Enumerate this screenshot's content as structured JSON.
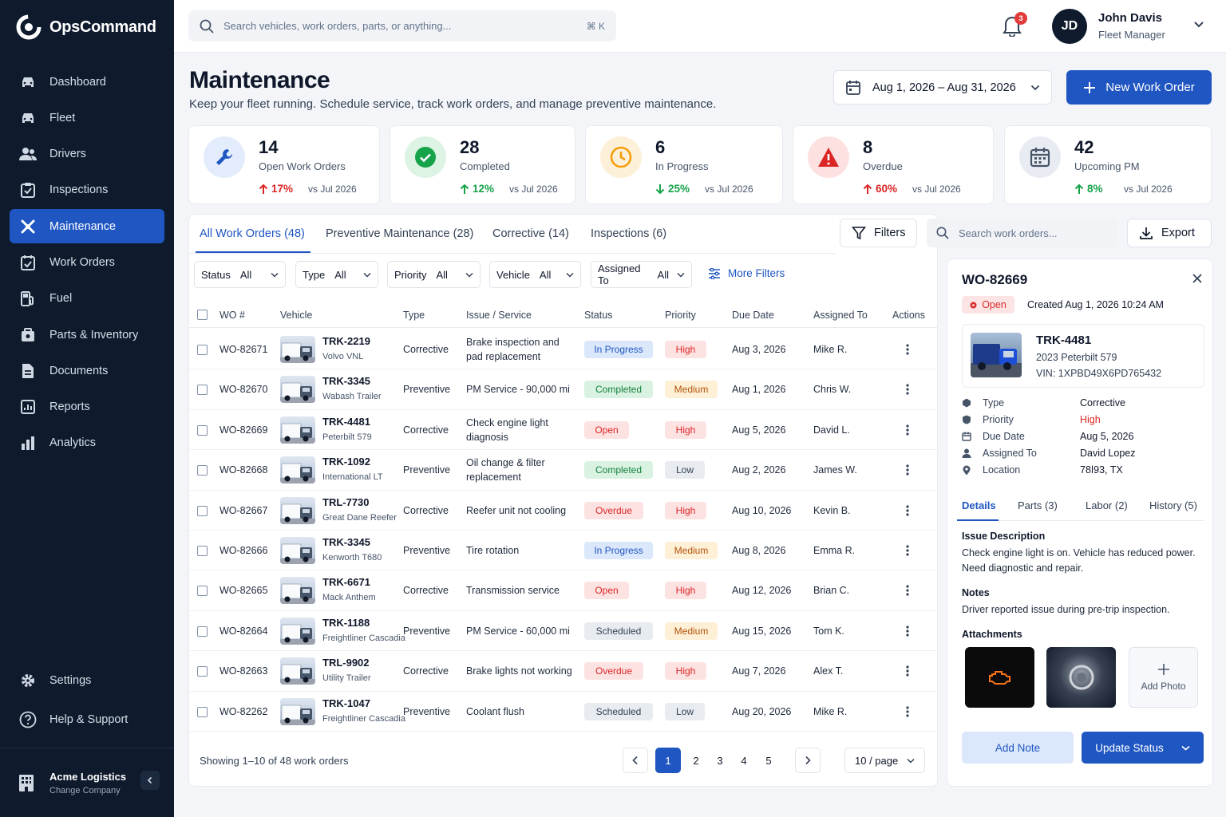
{
  "app": {
    "name": "OpsCommand"
  },
  "sidebar": {
    "items": [
      {
        "label": "Dashboard",
        "icon": "car-icon"
      },
      {
        "label": "Fleet",
        "icon": "car-icon"
      },
      {
        "label": "Drivers",
        "icon": "users-icon"
      },
      {
        "label": "Inspections",
        "icon": "clipboard-icon"
      },
      {
        "label": "Maintenance",
        "icon": "wrench-icon",
        "active": true
      },
      {
        "label": "Work Orders",
        "icon": "calendar-check-icon"
      },
      {
        "label": "Fuel",
        "icon": "fuel-icon"
      },
      {
        "label": "Parts & Inventory",
        "icon": "box-icon"
      },
      {
        "label": "Documents",
        "icon": "document-icon"
      },
      {
        "label": "Reports",
        "icon": "report-icon"
      },
      {
        "label": "Analytics",
        "icon": "bar-chart-icon"
      }
    ],
    "bottom": [
      {
        "label": "Settings"
      },
      {
        "label": "Help & Support"
      }
    ],
    "company": {
      "name": "Acme Logistics",
      "action": "Change Company"
    }
  },
  "topbar": {
    "search_placeholder": "Search vehicles, work orders, parts, or anything...",
    "shortcut": "⌘ K",
    "notifications": "3",
    "user": {
      "initials": "JD",
      "name": "John Davis",
      "role": "Fleet Manager"
    }
  },
  "header": {
    "title": "Maintenance",
    "subtitle": "Keep your fleet running. Schedule service, track work orders, and manage preventive maintenance.",
    "date_range": "Aug 1, 2026 – Aug 31, 2026",
    "new_button": "New Work Order"
  },
  "stats": [
    {
      "value": "14",
      "label": "Open Work Orders",
      "change": "17%",
      "direction": "up",
      "vs": "vs Jul 2026",
      "color": "#1f56c2"
    },
    {
      "value": "28",
      "label": "Completed",
      "change": "12%",
      "direction": "up",
      "vs": "vs Jul 2026",
      "color": "#16a34a"
    },
    {
      "value": "6",
      "label": "In Progress",
      "change": "25%",
      "direction": "down",
      "vs": "vs Jul 2026",
      "color": "#f59e0b"
    },
    {
      "value": "8",
      "label": "Overdue",
      "change": "60%",
      "direction": "up",
      "vs": "vs Jul 2026",
      "color": "#dc2626"
    },
    {
      "value": "42",
      "label": "Upcoming PM",
      "change": "8%",
      "direction": "up",
      "vs": "vs Jul 2026",
      "color": "#475569"
    }
  ],
  "tabs": [
    {
      "label": "All Work Orders (48)",
      "active": true
    },
    {
      "label": "Preventive Maintenance (28)"
    },
    {
      "label": "Corrective (14)"
    },
    {
      "label": "Inspections (6)"
    }
  ],
  "toolbar": {
    "filters": "Filters",
    "search_placeholder": "Search work orders...",
    "export": "Export",
    "more_filters": "More Filters"
  },
  "filters": [
    {
      "label": "Status",
      "value": "All"
    },
    {
      "label": "Type",
      "value": "All"
    },
    {
      "label": "Priority",
      "value": "All"
    },
    {
      "label": "Vehicle",
      "value": "All"
    },
    {
      "label": "Assigned To",
      "value": "All"
    }
  ],
  "table": {
    "columns": [
      "WO #",
      "Vehicle",
      "Type",
      "Issue / Service",
      "Status",
      "Priority",
      "Due Date",
      "Assigned To",
      "Actions"
    ],
    "rows": [
      {
        "wo": "WO-82671",
        "vehicle": "TRK-2219",
        "model": "Volvo VNL",
        "type": "Corrective",
        "issue": "Brake inspection and pad replacement",
        "status": "In Progress",
        "priority": "High",
        "due": "Aug 3, 2026",
        "assigned": "Mike R."
      },
      {
        "wo": "WO-82670",
        "vehicle": "TRK-3345",
        "model": "Wabash Trailer",
        "type": "Preventive",
        "issue": "PM Service - 90,000 mi",
        "status": "Completed",
        "priority": "Medium",
        "due": "Aug 1, 2026",
        "assigned": "Chris W."
      },
      {
        "wo": "WO-82669",
        "vehicle": "TRK-4481",
        "model": "Peterbilt 579",
        "type": "Corrective",
        "issue": "Check engine light diagnosis",
        "status": "Open",
        "priority": "High",
        "due": "Aug 5, 2026",
        "assigned": "David L."
      },
      {
        "wo": "WO-82668",
        "vehicle": "TRK-1092",
        "model": "International LT",
        "type": "Preventive",
        "issue": "Oil change & filter replacement",
        "status": "Completed",
        "priority": "Low",
        "due": "Aug 2, 2026",
        "assigned": "James W."
      },
      {
        "wo": "WO-82667",
        "vehicle": "TRL-7730",
        "model": "Great Dane Reefer",
        "type": "Corrective",
        "issue": "Reefer unit not cooling",
        "status": "Overdue",
        "priority": "High",
        "due": "Aug 10, 2026",
        "assigned": "Kevin B."
      },
      {
        "wo": "WO-82666",
        "vehicle": "TRK-3345",
        "model": "Kenworth T680",
        "type": "Preventive",
        "issue": "Tire rotation",
        "status": "In Progress",
        "priority": "Medium",
        "due": "Aug 8, 2026",
        "assigned": "Emma R."
      },
      {
        "wo": "WO-82665",
        "vehicle": "TRK-6671",
        "model": "Mack Anthem",
        "type": "Corrective",
        "issue": "Transmission service",
        "status": "Open",
        "priority": "High",
        "due": "Aug 12, 2026",
        "assigned": "Brian C."
      },
      {
        "wo": "WO-82664",
        "vehicle": "TRK-1188",
        "model": "Freightliner Cascadia",
        "type": "Preventive",
        "issue": "PM Service - 60,000 mi",
        "status": "Scheduled",
        "priority": "Medium",
        "due": "Aug 15, 2026",
        "assigned": "Tom K."
      },
      {
        "wo": "WO-82663",
        "vehicle": "TRL-9902",
        "model": "Utility Trailer",
        "type": "Corrective",
        "issue": "Brake lights not working",
        "status": "Overdue",
        "priority": "High",
        "due": "Aug 7, 2026",
        "assigned": "Alex T."
      },
      {
        "wo": "WO-82262",
        "vehicle": "TRK-1047",
        "model": "Freightliner Cascadia",
        "type": "Preventive",
        "issue": "Coolant flush",
        "status": "Scheduled",
        "priority": "Low",
        "due": "Aug 20, 2026",
        "assigned": "Mike R."
      }
    ]
  },
  "pagination": {
    "showing": "Showing 1–10 of 48 work orders",
    "pages": [
      "1",
      "2",
      "3",
      "4",
      "5"
    ],
    "current": "1",
    "per_page": "10 / page"
  },
  "detail": {
    "wo": "WO-82669",
    "status": "Open",
    "created": "Created Aug 1, 2026 10:24 AM",
    "vehicle": "TRK-4481",
    "model": "2023 Peterbilt 579",
    "vin": "VIN: 1XPBD49X6PD765432",
    "fields": [
      {
        "label": "Type",
        "value": "Corrective"
      },
      {
        "label": "Priority",
        "value": "High"
      },
      {
        "label": "Due Date",
        "value": "Aug 5, 2026"
      },
      {
        "label": "Assigned To",
        "value": "David Lopez"
      },
      {
        "label": "Location",
        "value": "78ǀ93, TX"
      }
    ],
    "tabs": [
      "Details",
      "Parts (3)",
      "Labor (2)",
      "History (5)"
    ],
    "issue_title": "Issue Description",
    "issue_text": "Check engine light is on. Vehicle has reduced power. Need diagnostic and repair.",
    "notes_title": "Notes",
    "notes_text": "Driver reported issue during pre-trip inspection.",
    "attachments_title": "Attachments",
    "add_photo": "Add Photo",
    "add_note": "Add Note",
    "update_status": "Update Status"
  },
  "colors": {
    "accent": "#1f56c2",
    "sidebar": "#0f1b2d"
  }
}
